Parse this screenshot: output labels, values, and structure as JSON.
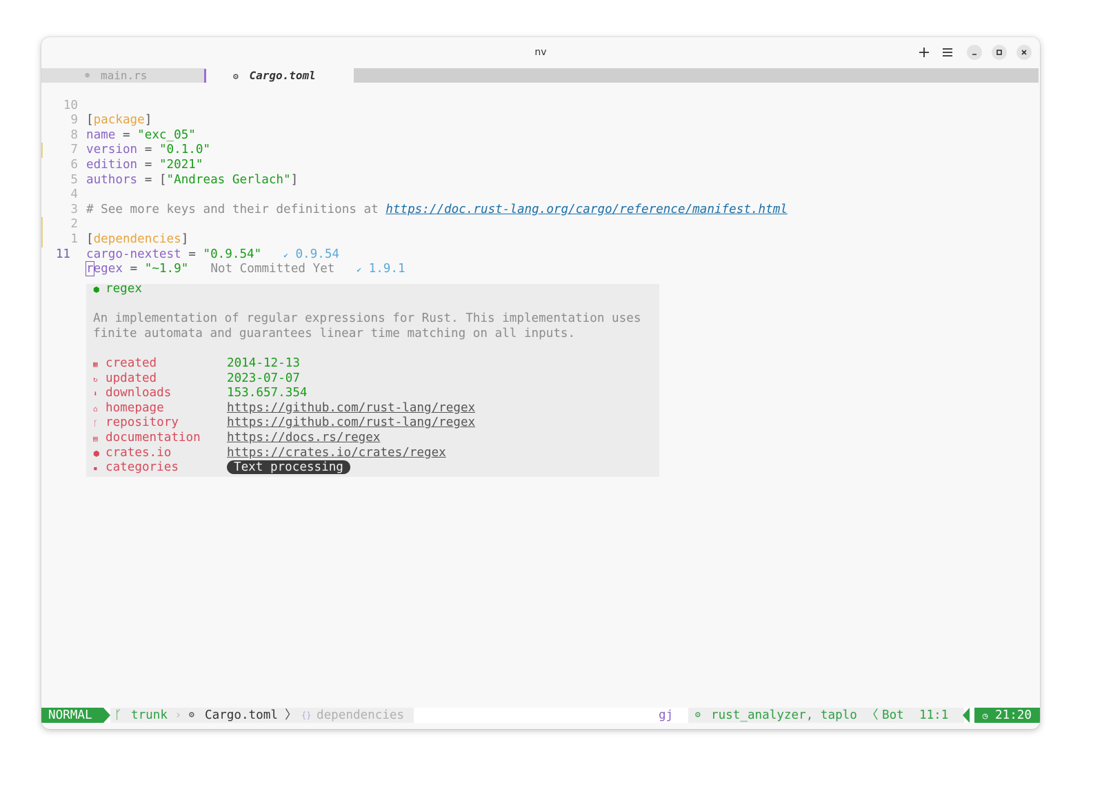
{
  "window": {
    "title": "nv"
  },
  "tabs": [
    {
      "icon": "rust-icon",
      "label": "main.rs",
      "active": false
    },
    {
      "icon": "gear-icon",
      "label": "Cargo.toml",
      "active": true
    }
  ],
  "editor": {
    "lines": [
      {
        "num": "10",
        "tokens": {
          "a": "[",
          "b": "package",
          "c": "]"
        }
      },
      {
        "num": "9",
        "key": "name",
        "eq": " = ",
        "val": "\"exc_05\""
      },
      {
        "num": "8",
        "key": "version",
        "eq": " = ",
        "val": "\"0.1.0\""
      },
      {
        "num": "7",
        "key": "edition",
        "eq": " = ",
        "val": "\"2021\""
      },
      {
        "num": "6",
        "key": "authors",
        "eq": " = [",
        "val": "\"Andreas Gerlach\"",
        "close": "]"
      },
      {
        "num": "5"
      },
      {
        "num": "4",
        "comment": "# See more keys and their definitions at ",
        "url": "https://doc.rust-lang.org/cargo/reference/manifest.html"
      },
      {
        "num": "3"
      },
      {
        "num": "2",
        "tokens": {
          "a": "[",
          "b": "dependencies",
          "c": "]"
        }
      },
      {
        "num": "1",
        "key": "cargo-nextest",
        "eq": " = ",
        "val": "\"0.9.54\"",
        "crate_version": "0.9.54"
      },
      {
        "num": "11",
        "cursor_char": "r",
        "key_rest": "egex",
        "eq": " = ",
        "val": "\"~1.9\"",
        "blame": "Not Committed Yet",
        "crate_version": "1.9.1"
      }
    ]
  },
  "crate_popup": {
    "name": "regex",
    "description_1": "An implementation of regular expressions for Rust. This implementation uses",
    "description_2": "finite automata and guarantees linear time matching on all inputs.",
    "fields": {
      "created": {
        "label": "created",
        "value": "2014-12-13"
      },
      "updated": {
        "label": "updated",
        "value": "2023-07-07"
      },
      "downloads": {
        "label": "downloads",
        "value": "153.657.354"
      },
      "homepage": {
        "label": "homepage",
        "value": "https://github.com/rust-lang/regex"
      },
      "repository": {
        "label": "repository",
        "value": "https://github.com/rust-lang/regex"
      },
      "documentation": {
        "label": "documentation",
        "value": "https://docs.rs/regex"
      },
      "crates_io": {
        "label": "crates.io",
        "value": "https://crates.io/crates/regex"
      },
      "categories": {
        "label": "categories",
        "value": "Text processing"
      }
    }
  },
  "statusline": {
    "mode": "NORMAL",
    "branch": "trunk",
    "file": "Cargo.toml",
    "breadcrumb": "dependencies",
    "keys": "gj",
    "lsp": "rust_analyzer, taplo",
    "position_label": "Bot",
    "cursor_pos": "11:1",
    "time": "21:20"
  },
  "colors": {
    "mode_bg": "#2ea043",
    "keyword": "#8a64c4",
    "string": "#1a9c1a",
    "section": "#e8a33a",
    "popup_label": "#d84a5a",
    "version_hint": "#5aa8d8"
  }
}
